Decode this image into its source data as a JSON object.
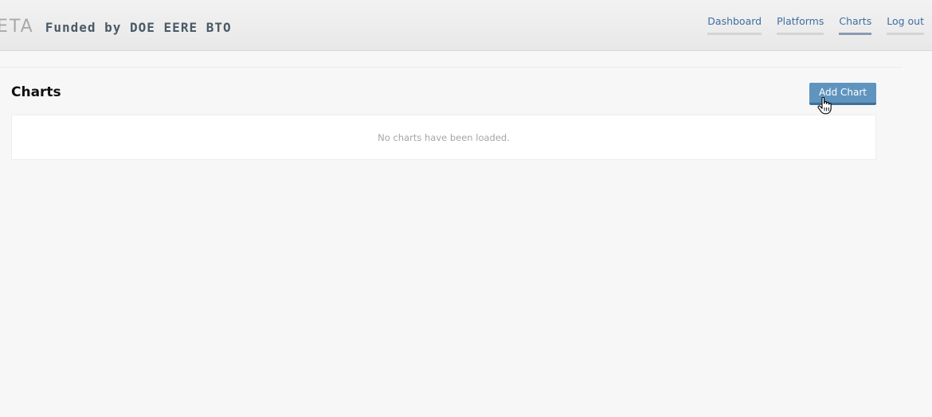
{
  "header": {
    "logo": "ETA",
    "funding": "Funded by DOE EERE BTO"
  },
  "nav": {
    "items": [
      {
        "label": "Dashboard",
        "active": false
      },
      {
        "label": "Platforms",
        "active": false
      },
      {
        "label": "Charts",
        "active": true
      },
      {
        "label": "Log out",
        "active": false
      }
    ]
  },
  "main": {
    "title": "Charts",
    "add_button_label": "Add Chart",
    "empty_message": "No charts have been loaded."
  },
  "colors": {
    "accent": "#5f94bf",
    "link": "#3f6ea0",
    "active_underline": "#8a9bb2"
  },
  "icons": {
    "cursor": "hand-pointer-icon"
  }
}
